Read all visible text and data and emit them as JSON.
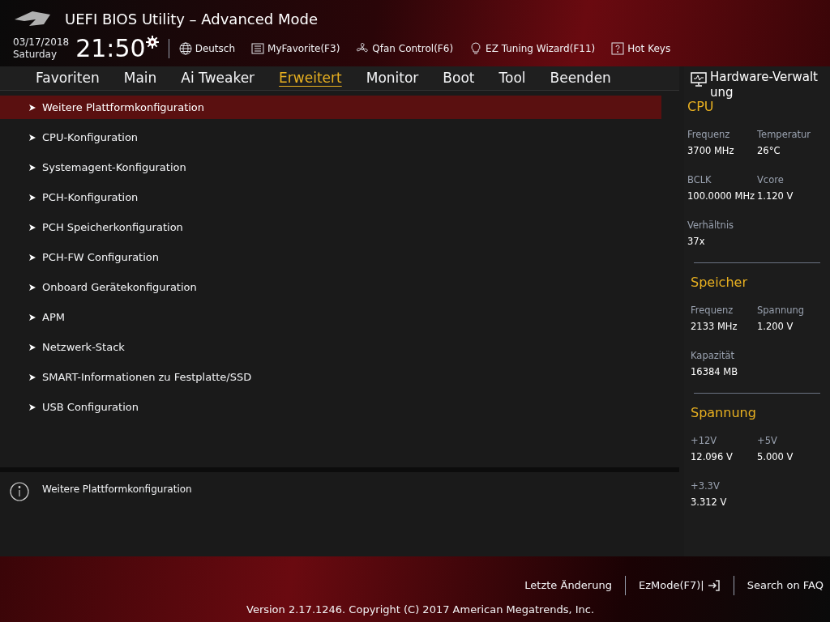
{
  "window": {
    "title": "UEFI BIOS Utility – Advanced Mode"
  },
  "clock": {
    "date": "03/17/2018",
    "day": "Saturday",
    "time": "21:50"
  },
  "toolbar": [
    {
      "kind": "globe",
      "label": "Deutsch"
    },
    {
      "kind": "list",
      "label": "MyFavorite(F3)"
    },
    {
      "kind": "fan",
      "label": "Qfan Control(F6)"
    },
    {
      "kind": "bulb",
      "label": "EZ Tuning Wizard(F11)"
    },
    {
      "kind": "help",
      "label": "Hot Keys"
    }
  ],
  "tabs": [
    {
      "label": "Favoriten",
      "selected": false
    },
    {
      "label": "Main",
      "selected": false
    },
    {
      "label": "Ai Tweaker",
      "selected": false
    },
    {
      "label": "Erweitert",
      "selected": true
    },
    {
      "label": "Monitor",
      "selected": false
    },
    {
      "label": "Boot",
      "selected": false
    },
    {
      "label": "Tool",
      "selected": false
    },
    {
      "label": "Beenden",
      "selected": false
    }
  ],
  "menu": [
    {
      "label": "Weitere Plattformkonfiguration",
      "selected": true
    },
    {
      "label": "CPU-Konfiguration",
      "selected": false
    },
    {
      "label": "Systemagent-Konfiguration",
      "selected": false
    },
    {
      "label": "PCH-Konfiguration",
      "selected": false
    },
    {
      "label": "PCH Speicherkonfiguration",
      "selected": false
    },
    {
      "label": "PCH-FW Configuration",
      "selected": false
    },
    {
      "label": "Onboard Gerätekonfiguration",
      "selected": false
    },
    {
      "label": "APM",
      "selected": false
    },
    {
      "label": "Netzwerk-Stack",
      "selected": false
    },
    {
      "label": "SMART-Informationen zu Festplatte/SSD",
      "selected": false
    },
    {
      "label": "USB Configuration",
      "selected": false
    }
  ],
  "help": {
    "text": "Weitere Plattformkonfiguration"
  },
  "hardware": {
    "title": "Hardware-Verwaltung",
    "sections": [
      {
        "title": "CPU",
        "items": [
          {
            "label": "Frequenz",
            "value": "3700 MHz"
          },
          {
            "label": "Temperatur",
            "value": "26°C"
          },
          {
            "label": "BCLK",
            "value": "100.0000 MHz"
          },
          {
            "label": "Vcore",
            "value": "1.120 V"
          },
          {
            "label": "Verhältnis",
            "value": "37x"
          }
        ]
      },
      {
        "title": "Speicher",
        "items": [
          {
            "label": "Frequenz",
            "value": "2133 MHz"
          },
          {
            "label": "Spannung",
            "value": "1.200 V"
          },
          {
            "label": "Kapazität",
            "value": "16384 MB"
          }
        ]
      },
      {
        "title": "Spannung",
        "items": [
          {
            "label": "+12V",
            "value": "12.096 V"
          },
          {
            "label": "+5V",
            "value": "5.000 V"
          },
          {
            "label": "+3.3V",
            "value": "3.312 V"
          }
        ]
      }
    ]
  },
  "footer": {
    "links": [
      {
        "kind": "text",
        "label": "Letzte Änderung"
      },
      {
        "kind": "exit",
        "label": "EzMode(F7)|"
      },
      {
        "kind": "text",
        "label": "Search on FAQ"
      }
    ],
    "version": "Version 2.17.1246. Copyright (C) 2017 American Megatrends, Inc."
  }
}
